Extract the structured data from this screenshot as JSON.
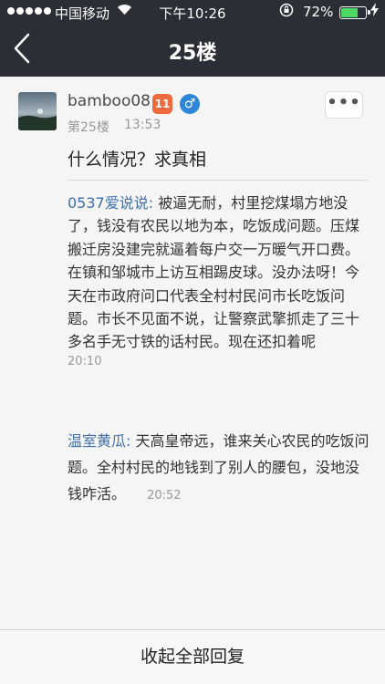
{
  "status_bar": {
    "carrier": "中国移动",
    "time": "下午10:26",
    "battery": "72%",
    "battery_level": 0.72,
    "wifi_icon": "wifi-icon",
    "lock_icon": "rotation-lock-icon",
    "charging_icon": "charging-bolt-icon"
  },
  "header": {
    "back_icon": "chevron-left-icon",
    "title": "25楼"
  },
  "post": {
    "username": "bamboo08",
    "level": "11",
    "level_color": "#f06a3f",
    "gender_icon": "♂",
    "gender_color": "#2d86d9",
    "floor": "第25楼",
    "time": "13:53",
    "more_icon": "•••",
    "content": "什么情况？求真相"
  },
  "replies": [
    {
      "name": "0537爱说说:",
      "text": "被逼无耐，村里挖煤塌方地没了，钱没有农民以地为本，吃饭成问题。压煤搬迁房没建完就逼着每户交一万暖气开口费。在镇和邹城市上访互相踢皮球。没办法呀！今天在市政府问口代表全村村民问市长吃饭问题。市长不见面不说，让警察武擎抓走了三十多名手无寸铁的话村民。现在还扣着呢",
      "time": "20:10"
    },
    {
      "name": "温室黄瓜:",
      "text": "天高皇帝远，谁来关心农民的吃饭问题。全村村民的地钱到了别人的腰包，没地没钱咋活。",
      "time": "20:52"
    }
  ],
  "footer": {
    "collapse_label": "收起全部回复"
  },
  "colors": {
    "header_bg": "#2b2f35",
    "link": "#3f6fae",
    "battery_fill": "#4cd964"
  }
}
